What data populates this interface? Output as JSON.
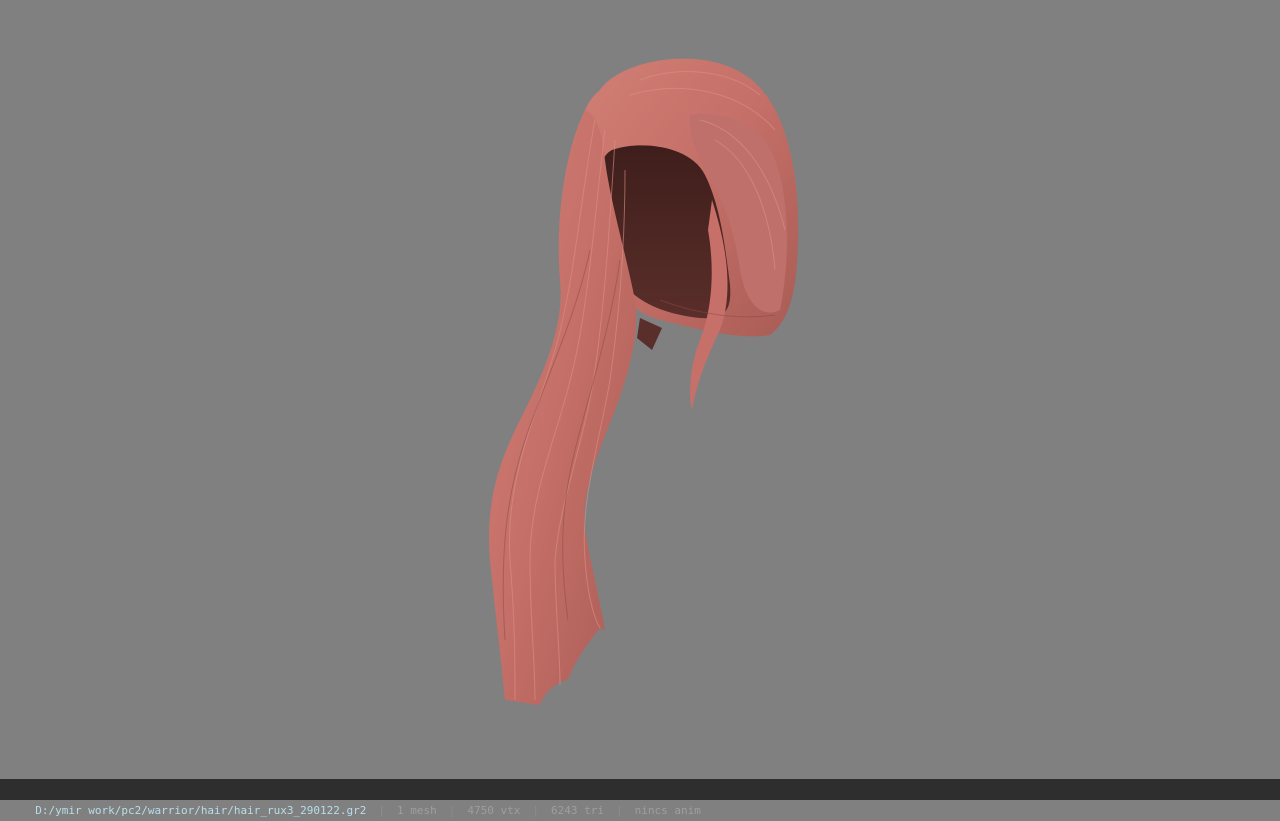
{
  "viewport": {
    "background_color": "#808080",
    "model": {
      "name": "hair-mesh",
      "base_color": "#c9736b",
      "shadow_color": "#6e3a36",
      "inner_color": "#4a2421"
    }
  },
  "status_bar": {
    "file_path": "D:/ymir work/pc2/warrior/hair/hair_rux3_290122.gr2",
    "separator": "|",
    "mesh_count": "1 mesh",
    "vertex_count": "4750 vtx",
    "triangle_count": "6243 tri",
    "anim_status": "nincs anim",
    "path_color": "#b7dde8",
    "background_color": "#2e2e2e"
  }
}
